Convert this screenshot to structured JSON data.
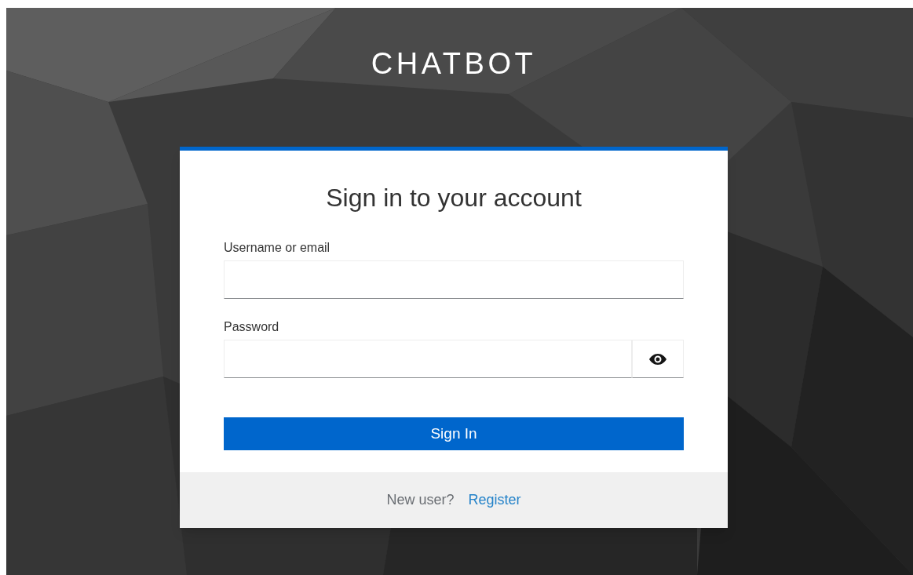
{
  "header": {
    "title": "CHATBOT"
  },
  "card": {
    "title": "Sign in to your account",
    "fields": [
      {
        "label": "Username or email",
        "kind": "text"
      },
      {
        "label": "Password",
        "kind": "password"
      }
    ],
    "submit": "Sign In",
    "footer": {
      "prompt": "New user?",
      "link": "Register"
    }
  }
}
